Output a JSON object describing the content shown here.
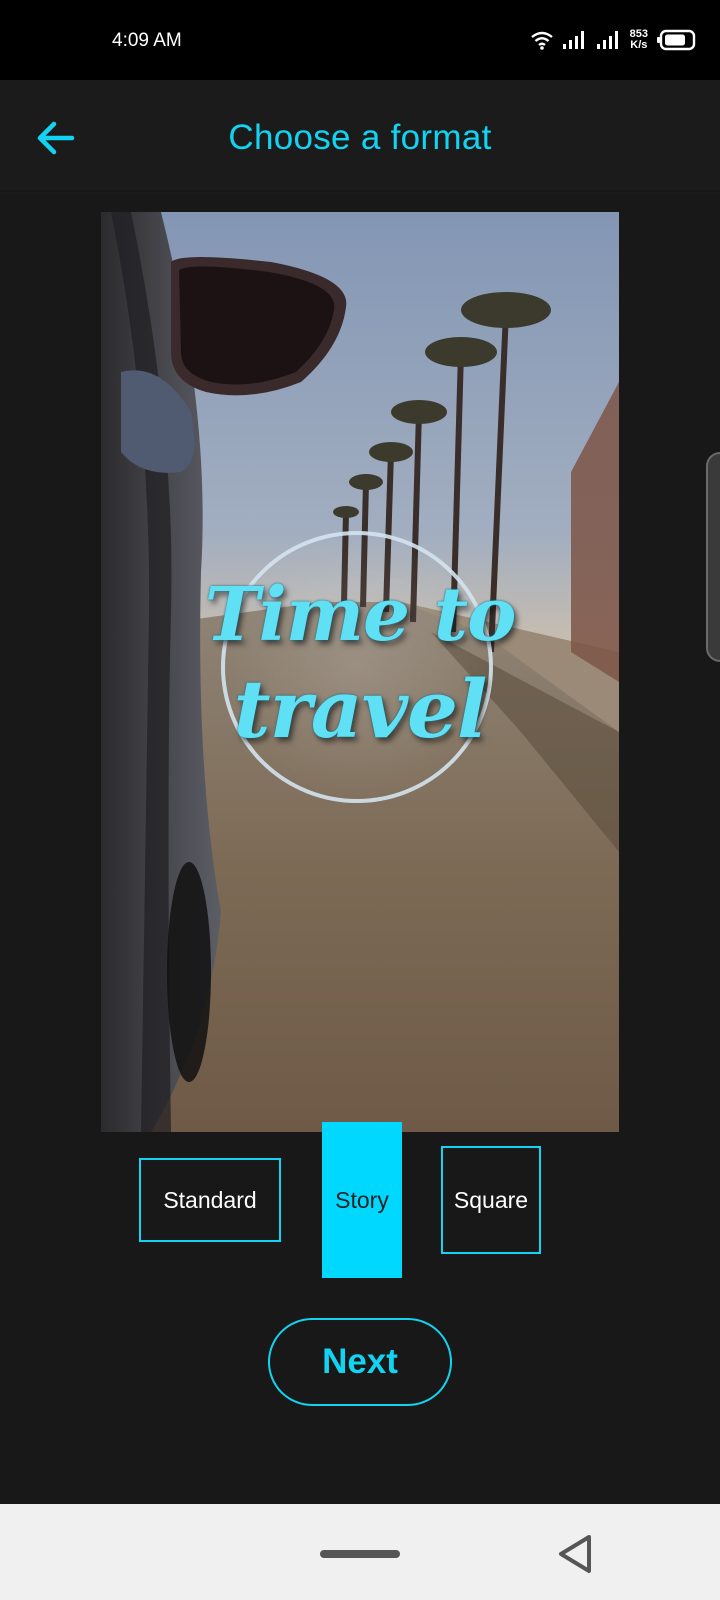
{
  "status_bar": {
    "time": "4:09 AM",
    "net_speed_value": "853",
    "net_speed_unit": "K/s",
    "icons": [
      "wifi-icon",
      "signal-icon",
      "signal-icon",
      "battery-icon"
    ]
  },
  "app_bar": {
    "title": "Choose a format",
    "back_icon": "arrow-left-icon"
  },
  "preview": {
    "title_line_1": "Time to",
    "title_line_2": "travel"
  },
  "formats": {
    "standard_label": "Standard",
    "story_label": "Story",
    "square_label": "Square",
    "selected": "Story"
  },
  "next_label": "Next",
  "nav_bar": {
    "icons": [
      "home-pill-icon",
      "back-triangle-icon"
    ]
  },
  "colors": {
    "accent": "#12d3f2",
    "selected_fill": "#00d8ff",
    "background": "#181818",
    "status_bar": "#000000",
    "nav_bar": "#f0f0f0"
  }
}
